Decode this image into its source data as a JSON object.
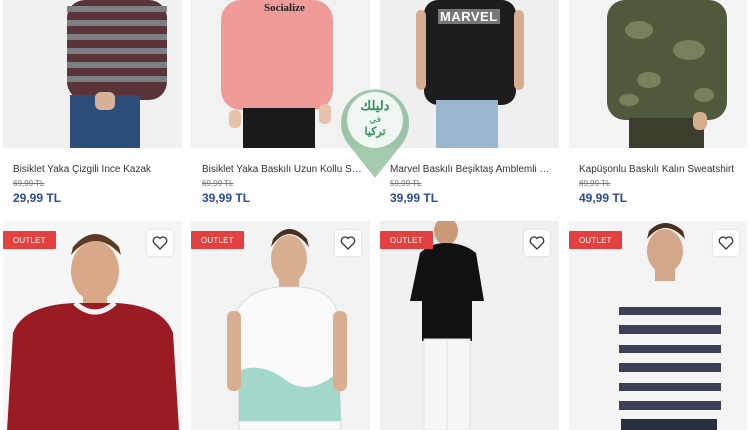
{
  "products_top": [
    {
      "title": "Bisiklet Yaka Çizgili İnce Kazak",
      "old_price": "69,99 TL",
      "price": "29,99 TL"
    },
    {
      "title": "Bisiklet Yaka Baskılı Uzun Kollu Swea...",
      "old_price": "69,99 TL",
      "price": "39,99 TL",
      "shirt_print": "Socialize"
    },
    {
      "title": "Marvel Baskılı Beşiktaş Amblemli Tiş...",
      "old_price": "59,99 TL",
      "price": "39,99 TL",
      "shirt_print": "MARVEL"
    },
    {
      "title": "Kapüşonlu Baskılı Kalın Sweatshirt",
      "old_price": "89,99 TL",
      "price": "49,99 TL"
    }
  ],
  "products_bottom": [
    {
      "badge": "OUTLET"
    },
    {
      "badge": "OUTLET"
    },
    {
      "badge": "OUTLET"
    },
    {
      "badge": "OUTLET"
    }
  ],
  "watermark": {
    "line1": "دليلك",
    "line2": "في",
    "line3": "تركيا"
  },
  "icons": {
    "favorite": "heart-icon"
  },
  "colors": {
    "price": "#2b4a9a",
    "badge": "#e3413f",
    "watermark_green": "#3aa86a"
  }
}
